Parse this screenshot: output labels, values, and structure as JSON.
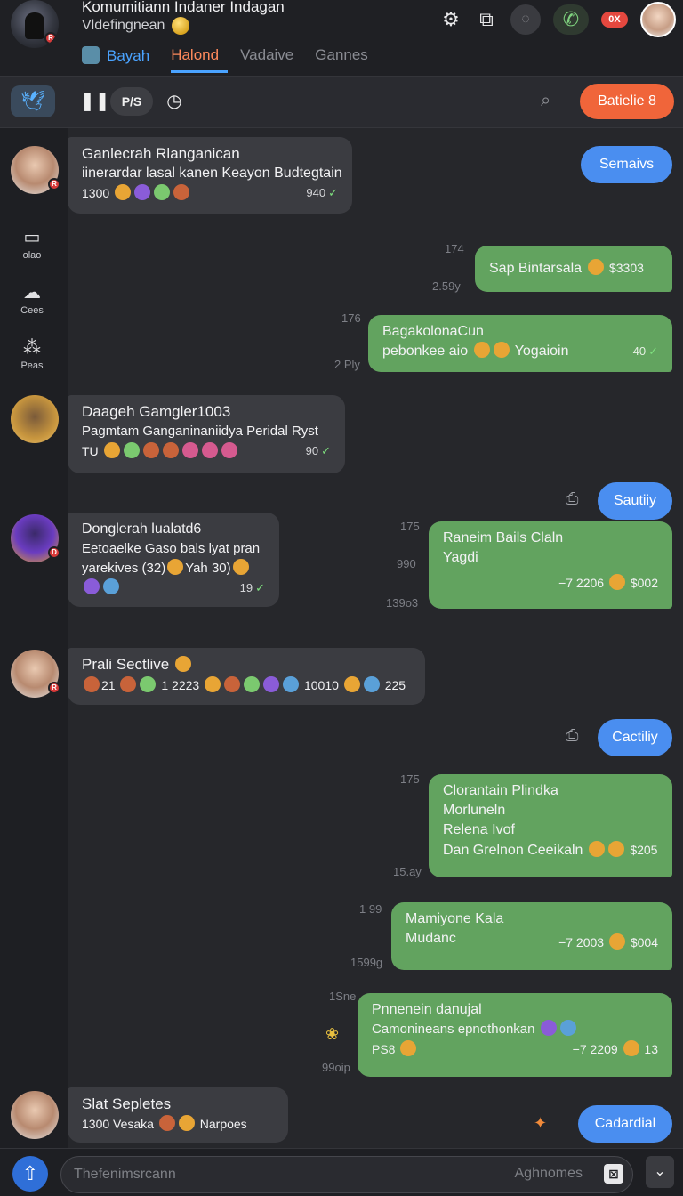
{
  "header": {
    "title": "Komumitiann Indaner Indagan",
    "subtitle": "Vldefingnean",
    "tabs": [
      {
        "label": "Bayah"
      },
      {
        "label": "Halond"
      },
      {
        "label": "Vadaive"
      },
      {
        "label": "Gannes"
      }
    ],
    "notif_pill": "0X"
  },
  "toolbar": {
    "pill_label": "P/S",
    "action_label": "Batielie 8"
  },
  "sidebar": {
    "items": [
      {
        "label": "olao"
      },
      {
        "label": "Cees"
      },
      {
        "label": "Peas"
      }
    ]
  },
  "messages": [
    {
      "dir": "in",
      "title": "Ganlecrah Rlanganican",
      "lines": [
        "iinerardar lasal kanen Keayon Budtegtain"
      ],
      "footer": "1300",
      "time": "940"
    },
    {
      "dir": "out",
      "lines": [
        "Sap Bintarsala"
      ],
      "extra": "$3303",
      "left_top": "174",
      "left_bottom": "2.59y"
    },
    {
      "dir": "out",
      "lines": [
        "BagakolonaCun",
        "pebonkee aio"
      ],
      "extra": "Yogaioin",
      "time": "40",
      "left_top": "176",
      "left_bottom": "2 Ply"
    },
    {
      "dir": "in",
      "title": "Daageh Gamgler1003",
      "lines": [
        "Pagmtam Ganganinaniidya Peridal Ryst"
      ],
      "footer": "TU",
      "time": "90"
    },
    {
      "dir": "in",
      "title": "Donglerah lualatd6",
      "lines": [
        "Eetoaelke Gaso bals lyat pran",
        "yarekives (32)",
        "Yah 30)"
      ],
      "time": "19"
    },
    {
      "dir": "out",
      "lines": [
        "Raneim Bails Claln",
        "Yagdi"
      ],
      "extra": "−7 2206",
      "amount": "$002",
      "left_top": "175",
      "left_mid": "990",
      "left_bottom": "139o3"
    },
    {
      "dir": "in",
      "title": "Prali Sectlive",
      "footer_parts": [
        "21",
        "1 2223",
        "10010",
        "225"
      ]
    },
    {
      "dir": "out",
      "lines": [
        "Clorantain Plindka",
        "Morluneln",
        "Relena Ivof",
        "Dan Grelnon Ceeikaln"
      ],
      "amount": "$205",
      "left_top": "175",
      "left_bottom": "15.ay"
    },
    {
      "dir": "out",
      "lines": [
        "Mamiyone Kala",
        "Mudanc"
      ],
      "extra": "−7 2003",
      "amount": "$004",
      "left_top": "1 99",
      "left_bottom": "1599g"
    },
    {
      "dir": "out",
      "lines": [
        "Pnnenein danujal",
        "Camonineans epnothonkan"
      ],
      "footer": "PS8",
      "extra": "−7 2209",
      "amount": "13",
      "left_top": "1Sne",
      "left_bottom": "99oip"
    },
    {
      "dir": "in",
      "title": "Slat Sepletes",
      "footer_parts": [
        "1300",
        "Vesaka",
        "Narpoes"
      ]
    }
  ],
  "chips": [
    {
      "label": "Semaivs"
    },
    {
      "label": "Sautiiy"
    },
    {
      "label": "Cactiliy"
    },
    {
      "label": "Cadardial"
    }
  ],
  "composer": {
    "placeholder": "Thefenimsrcann",
    "hint": "Aghnomes"
  },
  "colors": {
    "accent_blue": "#4a8ef0",
    "outgoing_green": "#62a35f",
    "incoming_gray": "#3b3c41",
    "action_orange": "#f0653a"
  }
}
